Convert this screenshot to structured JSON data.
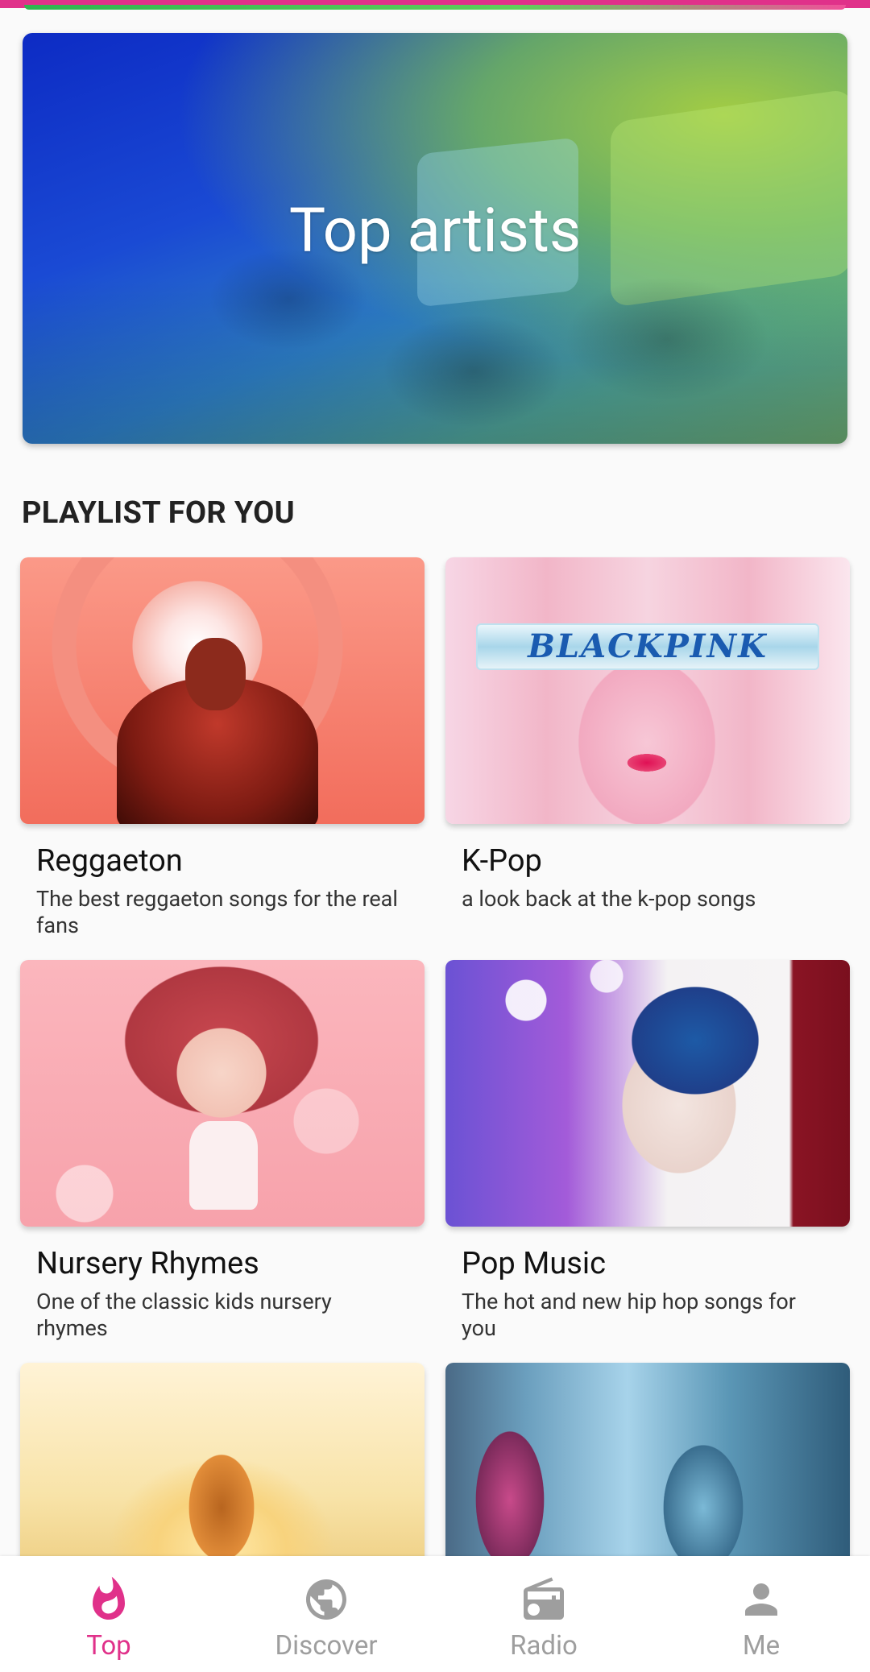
{
  "hero": {
    "title": "Top artists"
  },
  "section": {
    "title": "PLAYLIST FOR YOU"
  },
  "playlists": [
    {
      "title": "Reggaeton",
      "description": "The best reggaeton songs for the real fans"
    },
    {
      "title": "K-Pop",
      "description": "a look back at the k-pop songs",
      "thumb_text": "BLACKPINK"
    },
    {
      "title": "Nursery Rhymes",
      "description": "One of the classic kids nursery rhymes"
    },
    {
      "title": "Pop Music",
      "description": "The hot and new hip hop songs for you"
    }
  ],
  "nav": {
    "items": [
      {
        "label": "Top",
        "icon": "flame-icon",
        "active": true
      },
      {
        "label": "Discover",
        "icon": "globe-icon",
        "active": false
      },
      {
        "label": "Radio",
        "icon": "radio-icon",
        "active": false
      },
      {
        "label": "Me",
        "icon": "person-icon",
        "active": false
      }
    ]
  },
  "colors": {
    "accent": "#e0318a",
    "inactive": "#9e9e9e",
    "background": "#fafafa"
  }
}
